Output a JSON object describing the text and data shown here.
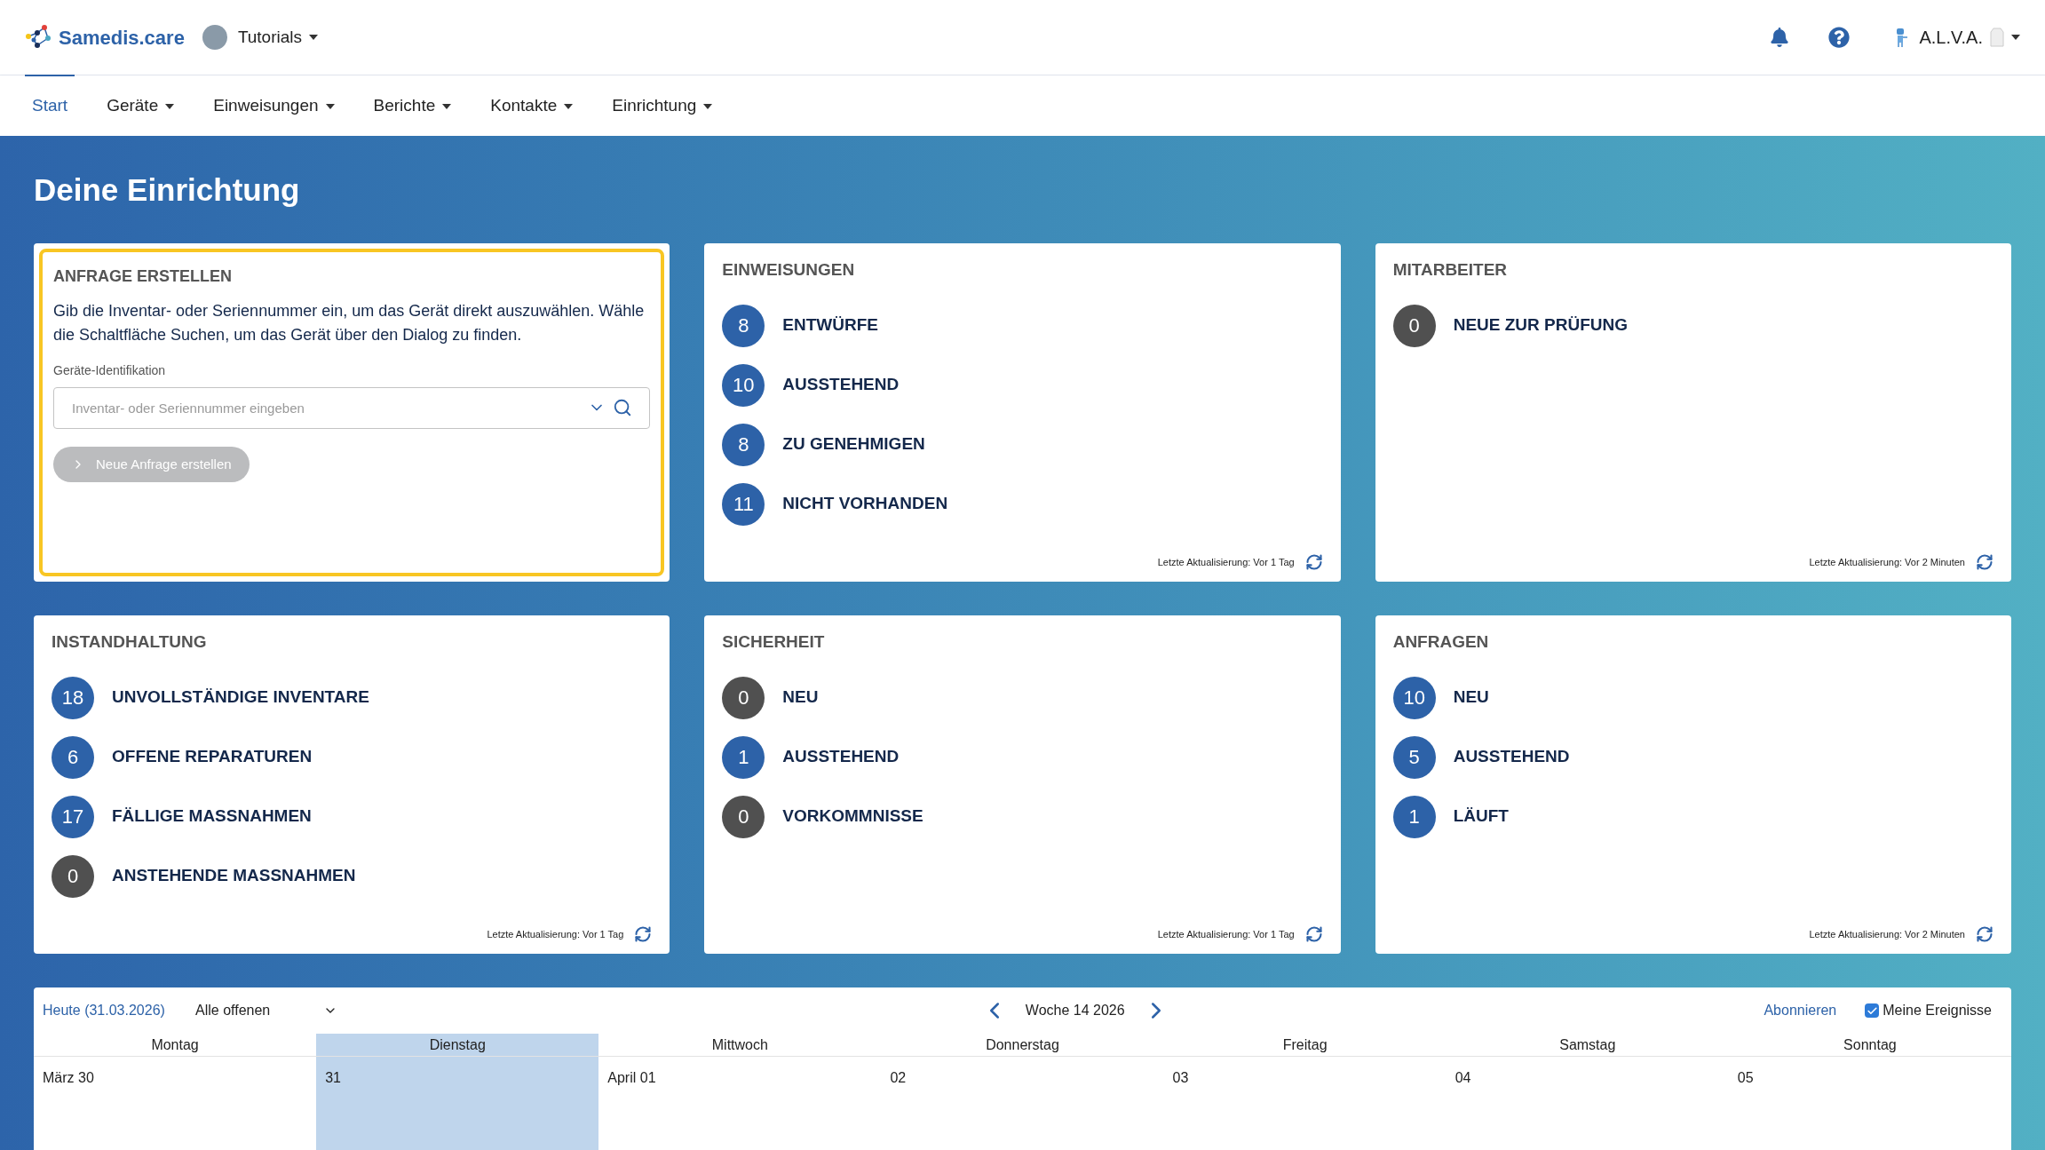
{
  "header": {
    "brand": "Samedis.care",
    "tenant": "Tutorials",
    "user": "A.L.V.A."
  },
  "nav": [
    {
      "label": "Start",
      "selected": true,
      "dropdown": false
    },
    {
      "label": "Geräte",
      "selected": false,
      "dropdown": true
    },
    {
      "label": "Einweisungen",
      "selected": false,
      "dropdown": true
    },
    {
      "label": "Berichte",
      "selected": false,
      "dropdown": true
    },
    {
      "label": "Kontakte",
      "selected": false,
      "dropdown": true
    },
    {
      "label": "Einrichtung",
      "selected": false,
      "dropdown": true
    }
  ],
  "page_title": "Deine Einrichtung",
  "request_card": {
    "title": "ANFRAGE ERSTELLEN",
    "highlighted": true,
    "text": "Gib die Inventar- oder Seriennummer ein, um das Gerät direkt auszuwählen. Wähle die Schaltfläche Suchen, um das Gerät über den Dialog zu finden.",
    "field_label": "Geräte-Identifikation",
    "placeholder": "Inventar- oder Seriennummer eingeben",
    "button": "Neue Anfrage erstellen",
    "button_disabled": true
  },
  "cards": [
    {
      "title": "EINWEISUNGEN",
      "footer": "Letzte Aktualisierung: Vor 1 Tag",
      "items": [
        {
          "count": "8",
          "label": "ENTWÜRFE",
          "color": "#2d62a8"
        },
        {
          "count": "10",
          "label": "AUSSTEHEND",
          "color": "#2d62a8"
        },
        {
          "count": "8",
          "label": "ZU GENEHMIGEN",
          "color": "#2d62a8"
        },
        {
          "count": "11",
          "label": "NICHT VORHANDEN",
          "color": "#2d62a8"
        }
      ]
    },
    {
      "title": "MITARBEITER",
      "footer": "Letzte Aktualisierung: Vor 2 Minuten",
      "items": [
        {
          "count": "0",
          "label": "NEUE ZUR PRÜFUNG",
          "color": "#505050"
        }
      ]
    },
    {
      "title": "INSTANDHALTUNG",
      "footer": "Letzte Aktualisierung: Vor 1 Tag",
      "items": [
        {
          "count": "18",
          "label": "UNVOLLSTÄNDIGE INVENTARE",
          "color": "#2d62a8"
        },
        {
          "count": "6",
          "label": "OFFENE REPARATUREN",
          "color": "#2d62a8"
        },
        {
          "count": "17",
          "label": "FÄLLIGE MASSNAHMEN",
          "color": "#2d62a8"
        },
        {
          "count": "0",
          "label": "ANSTEHENDE MASSNAHMEN",
          "color": "#505050"
        }
      ]
    },
    {
      "title": "SICHERHEIT",
      "footer": "Letzte Aktualisierung: Vor 1 Tag",
      "items": [
        {
          "count": "0",
          "label": "NEU",
          "color": "#505050"
        },
        {
          "count": "1",
          "label": "AUSSTEHEND",
          "color": "#2d62a8"
        },
        {
          "count": "0",
          "label": "VORKOMMNISSE",
          "color": "#505050"
        }
      ]
    },
    {
      "title": "ANFRAGEN",
      "footer": "Letzte Aktualisierung: Vor 2 Minuten",
      "items": [
        {
          "count": "10",
          "label": "NEU",
          "color": "#2d62a8"
        },
        {
          "count": "5",
          "label": "AUSSTEHEND",
          "color": "#2d62a8"
        },
        {
          "count": "1",
          "label": "LÄUFT",
          "color": "#2d62a8"
        }
      ]
    }
  ],
  "calendar": {
    "today": "Heute (31.03.2026)",
    "filter": "Alle offenen",
    "week": "Woche 14 2026",
    "subscribe": "Abonnieren",
    "my_events": {
      "label": "Meine Ereignisse",
      "checked": true
    },
    "days": [
      {
        "name": "Montag",
        "date": "März 30",
        "selected": false
      },
      {
        "name": "Dienstag",
        "date": "31",
        "selected": true
      },
      {
        "name": "Mittwoch",
        "date": "April 01",
        "selected": false
      },
      {
        "name": "Donnerstag",
        "date": "02",
        "selected": false
      },
      {
        "name": "Freitag",
        "date": "03",
        "selected": false
      },
      {
        "name": "Samstag",
        "date": "04",
        "selected": false
      },
      {
        "name": "Sonntag",
        "date": "05",
        "selected": false
      }
    ]
  }
}
